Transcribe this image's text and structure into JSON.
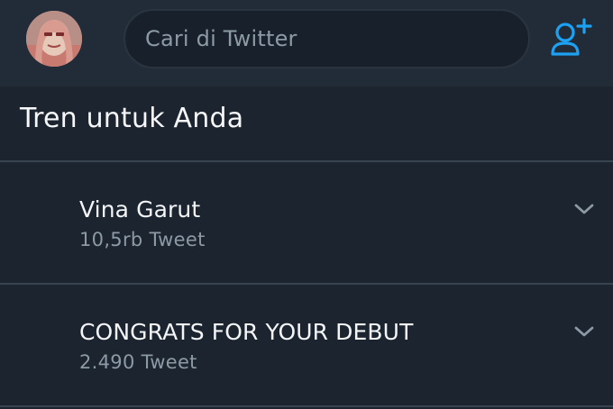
{
  "header": {
    "search_placeholder": "Cari di Twitter"
  },
  "section": {
    "title": "Tren untuk Anda"
  },
  "trends": [
    {
      "name": "Vina Garut",
      "count": "10,5rb Tweet"
    },
    {
      "name": "CONGRATS FOR YOUR DEBUT",
      "count": "2.490 Tweet"
    }
  ],
  "colors": {
    "background": "#1b242f",
    "header_bg": "#222c38",
    "accent": "#1da1f2",
    "secondary_text": "#8c9aa6"
  },
  "icons": {
    "add_user": "add-user-icon",
    "trend_menu": "chevron-down-icon"
  }
}
